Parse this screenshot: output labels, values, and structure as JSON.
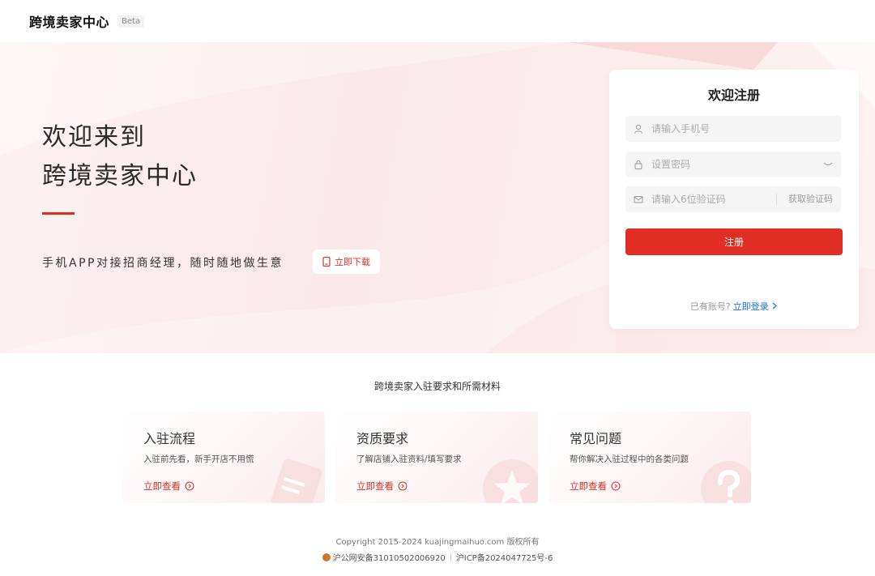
{
  "header": {
    "logo": "跨境卖家中心",
    "badge": "Beta"
  },
  "hero": {
    "title_line1": "欢迎来到",
    "title_line2": "跨境卖家中心",
    "subtitle": "手机APP对接招商经理，随时随地做生意",
    "download_label": "立即下载"
  },
  "register": {
    "title": "欢迎注册",
    "phone_placeholder": "请输入手机号",
    "password_placeholder": "设置密码",
    "code_placeholder": "请输入6位验证码",
    "get_code_label": "获取验证码",
    "submit_label": "注册",
    "has_account": "已有账号?",
    "login_link": "立即登录"
  },
  "section": {
    "title": "跨境卖家入驻要求和所需材料",
    "cards": [
      {
        "title": "入驻流程",
        "desc": "入驻前先看，新手开店不用慌",
        "link": "立即查看"
      },
      {
        "title": "资质要求",
        "desc": "了解店铺入驻资料/填写要求",
        "link": "立即查看"
      },
      {
        "title": "常见问题",
        "desc": "帮你解决入驻过程中的各类问题",
        "link": "立即查看"
      }
    ]
  },
  "footer": {
    "copyright": "Copyright 2015-2024 kuajingmaihuo.com 版权所有",
    "police": "沪公网安备31010502006920",
    "icp": "沪ICP备2024047725号-6"
  },
  "colors": {
    "accent": "#e02e24",
    "link": "#1a73e8"
  }
}
